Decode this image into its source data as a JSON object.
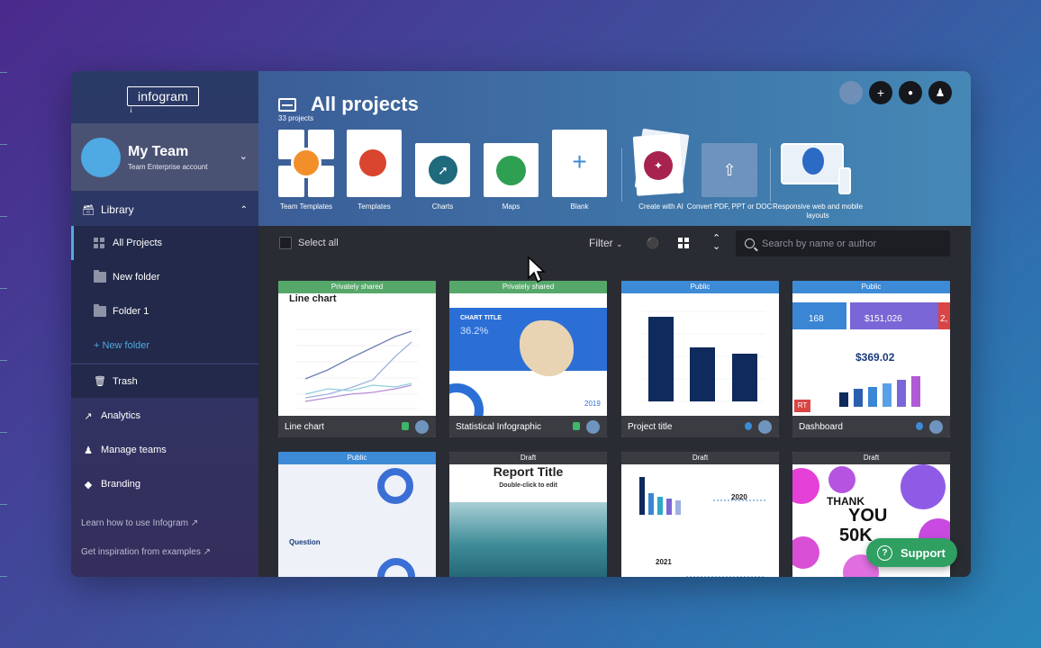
{
  "app": {
    "logo": "infogram"
  },
  "team": {
    "name": "My Team",
    "subtitle": "Team Enterprise account"
  },
  "sidebar": {
    "library_label": "Library",
    "items": [
      {
        "label": "All Projects"
      },
      {
        "label": "New folder"
      },
      {
        "label": "Folder 1"
      },
      {
        "label": "+ New folder"
      }
    ],
    "trash_label": "Trash",
    "links": [
      {
        "label": "Analytics"
      },
      {
        "label": "Manage teams"
      },
      {
        "label": "Branding"
      }
    ],
    "help_links": [
      {
        "label": "Learn how to use Infogram"
      },
      {
        "label": "Get inspiration from examples"
      }
    ]
  },
  "header": {
    "title": "All projects",
    "count": "33 projects",
    "templates": [
      {
        "label": "Team Templates"
      },
      {
        "label": "Templates"
      },
      {
        "label": "Charts"
      },
      {
        "label": "Maps"
      },
      {
        "label": "Blank"
      },
      {
        "label": "Create with AI"
      },
      {
        "label": "Convert PDF, PPT or DOC"
      },
      {
        "label": "Responsive web and mobile layouts"
      }
    ]
  },
  "toolbar": {
    "select_all": "Select all",
    "filter": "Filter",
    "search_placeholder": "Search by name or author"
  },
  "projects": [
    {
      "badge": "Privately shared",
      "title": "Line chart",
      "thumb_title": "Line chart"
    },
    {
      "badge": "Privately shared",
      "title": "Statistical Infographic",
      "thumb_title": "CHART TITLE",
      "thumb_num": "36.2%",
      "thumb_year": "2019"
    },
    {
      "badge": "Public",
      "title": "Project title"
    },
    {
      "badge": "Public",
      "title": "Dashboard",
      "kpis": [
        "168",
        "$151,026",
        "2,"
      ],
      "value": "$369.02",
      "rt": "RT"
    },
    {
      "badge": "Public",
      "title": "",
      "section": "Question"
    },
    {
      "badge": "Draft",
      "title": "",
      "thumb_title": "Report Title",
      "thumb_sub": "Double-click to edit"
    },
    {
      "badge": "Draft",
      "title": "",
      "years": [
        "2020",
        "2021"
      ]
    },
    {
      "badge": "Draft",
      "title": "",
      "lines": [
        "THANK",
        "YOU",
        "50K"
      ]
    }
  ],
  "support": {
    "label": "Support"
  },
  "colors": {
    "accent": "#4fa9e3",
    "support": "#2f9f62",
    "badge_private": "#56a86a",
    "badge_public": "#3d8ad6",
    "badge_draft": "#3a3c42"
  }
}
